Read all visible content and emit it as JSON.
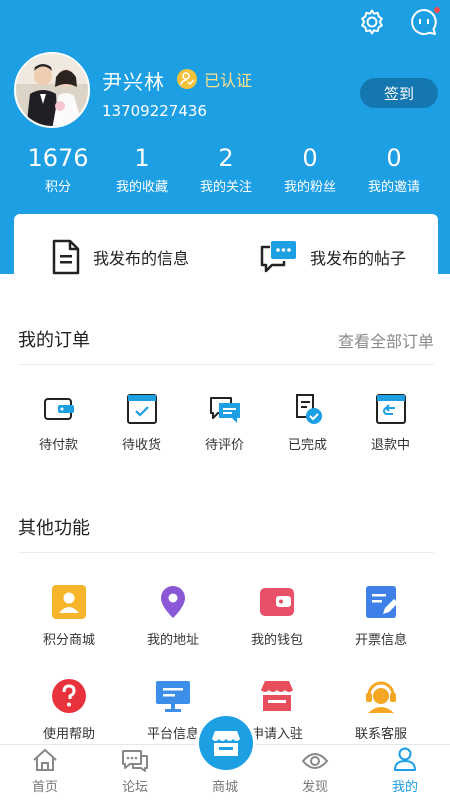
{
  "colors": {
    "brand": "#1d9fe4",
    "signin_bg": "#1477b0",
    "verified": "#ffe08a",
    "active_tab": "#1d9fe4"
  },
  "header": {
    "icons": [
      "settings-icon",
      "message-icon"
    ],
    "user": {
      "name": "尹兴林",
      "verified_label": "已认证",
      "phone": "13709227436"
    },
    "signin_label": "签到"
  },
  "stats": [
    {
      "value": "1676",
      "label": "积分"
    },
    {
      "value": "1",
      "label": "我的收藏"
    },
    {
      "value": "2",
      "label": "我的关注"
    },
    {
      "value": "0",
      "label": "我的粉丝"
    },
    {
      "value": "0",
      "label": "我的邀请"
    }
  ],
  "posts": {
    "my_info": {
      "label": "我发布的信息",
      "icon": "document-icon"
    },
    "my_posts": {
      "label": "我发布的帖子",
      "icon": "chat-bubbles-icon"
    }
  },
  "orders": {
    "title": "我的订单",
    "view_all": "查看全部订单",
    "items": [
      {
        "label": "待付款",
        "icon": "wallet-icon"
      },
      {
        "label": "待收货",
        "icon": "package-icon"
      },
      {
        "label": "待评价",
        "icon": "review-icon"
      },
      {
        "label": "已完成",
        "icon": "done-icon"
      },
      {
        "label": "退款中",
        "icon": "refund-icon"
      }
    ]
  },
  "functions": {
    "title": "其他功能",
    "items": [
      {
        "label": "积分商城",
        "icon": "points-mall-icon",
        "color": "#f7b52c"
      },
      {
        "label": "我的地址",
        "icon": "location-icon",
        "color": "#8a57d6"
      },
      {
        "label": "我的钱包",
        "icon": "wallet-icon",
        "color": "#e8506a"
      },
      {
        "label": "开票信息",
        "icon": "invoice-icon",
        "color": "#3f7fe8"
      },
      {
        "label": "使用帮助",
        "icon": "help-icon",
        "color": "#e8323c"
      },
      {
        "label": "平台信息",
        "icon": "monitor-icon",
        "color": "#3d8ee8"
      },
      {
        "label": "申请入驻",
        "icon": "store-icon",
        "color": "#e84d5c"
      },
      {
        "label": "联系客服",
        "icon": "customer-service-icon",
        "color": "#f5a623"
      }
    ]
  },
  "tabbar": {
    "items": [
      {
        "label": "首页",
        "icon": "home-icon"
      },
      {
        "label": "论坛",
        "icon": "forum-icon"
      },
      {
        "label": "商城",
        "icon": "shop-icon"
      },
      {
        "label": "发现",
        "icon": "eye-icon"
      },
      {
        "label": "我的",
        "icon": "user-icon"
      }
    ],
    "active": "我的"
  }
}
